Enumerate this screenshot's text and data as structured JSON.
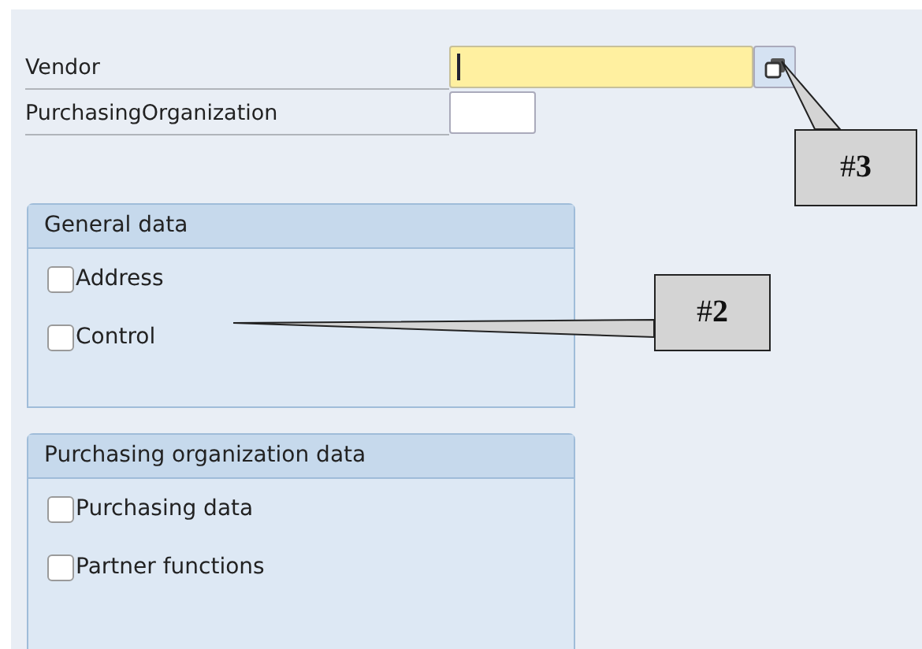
{
  "fields": [
    {
      "label": "Vendor",
      "focused": true,
      "has_button": true
    },
    {
      "label": "PurchasingOrganization",
      "focused": false,
      "has_button": false
    }
  ],
  "groups": [
    {
      "title": "General data",
      "items": [
        {
          "label": "Address",
          "checked": false
        },
        {
          "label": "Control",
          "checked": false
        }
      ]
    },
    {
      "title": "Purchasing organization data",
      "items": [
        {
          "label": "Purchasing data",
          "checked": false
        },
        {
          "label": "Partner functions",
          "checked": false
        }
      ]
    }
  ],
  "callouts": [
    {
      "text": "#**2**"
    },
    {
      "text": "#**3**"
    }
  ]
}
